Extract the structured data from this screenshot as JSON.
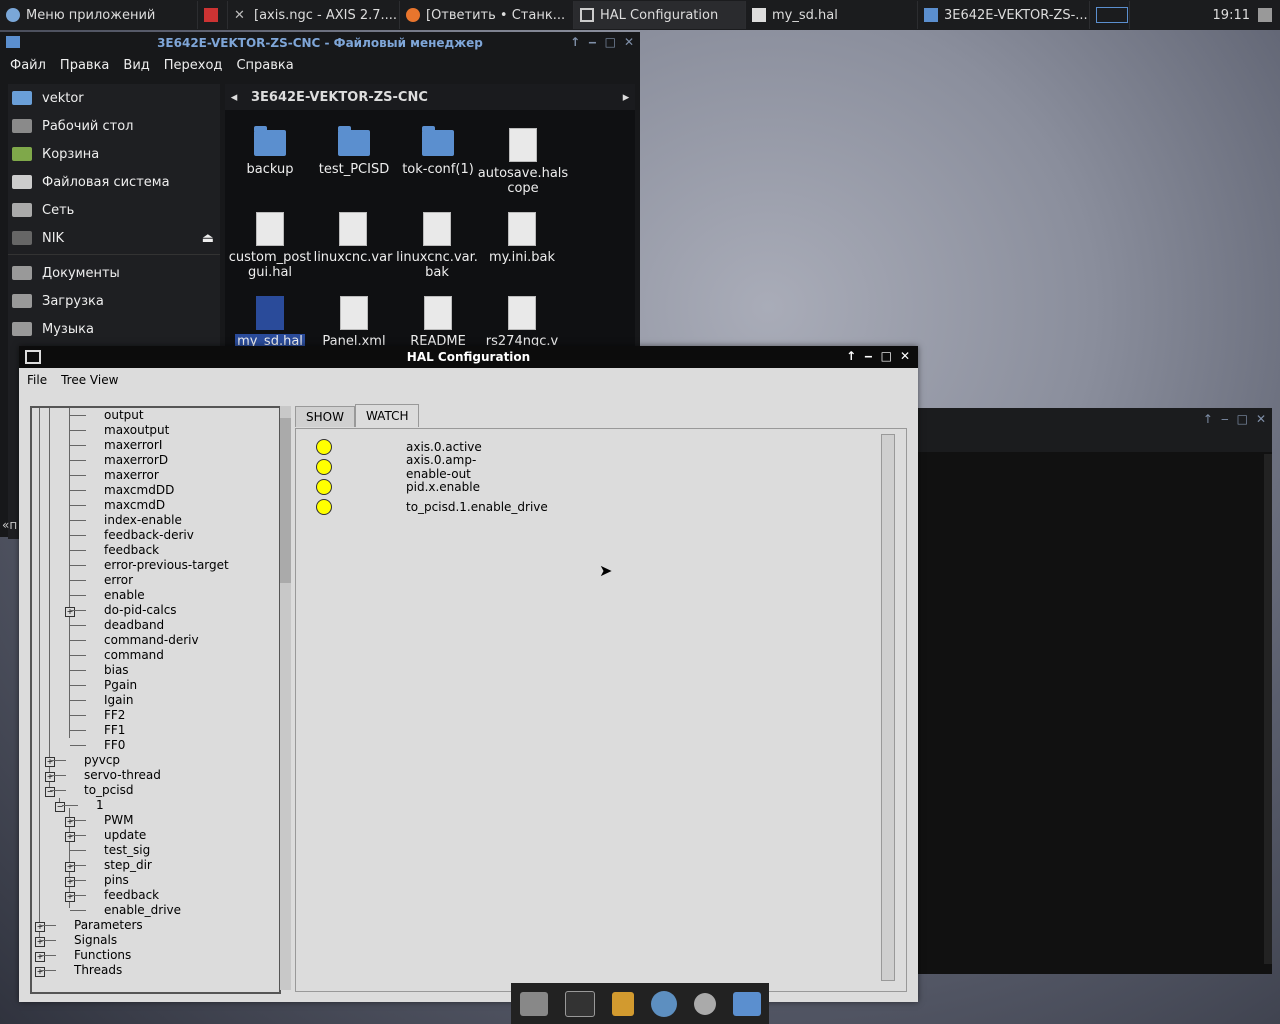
{
  "taskbar": {
    "app_menu": "Меню приложений",
    "tasks": [
      {
        "label": "[axis.ngc - AXIS 2.7...."
      },
      {
        "label": "[Ответить • Станк..."
      },
      {
        "label": "HAL Configuration"
      },
      {
        "label": "my_sd.hal"
      },
      {
        "label": "3E642E-VEKTOR-ZS-..."
      }
    ],
    "clock": "19:11"
  },
  "file_manager": {
    "title": "3E642E-VEKTOR-ZS-CNC - Файловый менеджер",
    "menu": [
      "Файл",
      "Правка",
      "Вид",
      "Переход",
      "Справка"
    ],
    "sidebar": [
      "vektor",
      "Рабочий стол",
      "Корзина",
      "Файловая система",
      "Сеть",
      "NIK",
      "Документы",
      "Загрузка",
      "Музыка"
    ],
    "path": "3E642E-VEKTOR-ZS-CNC",
    "files": [
      "backup",
      "test_PCISD",
      "tok-conf(1)",
      "autosave.halscope",
      "custom_postgui.hal",
      "linuxcnc.var",
      "linuxcnc.var.bak",
      "my.ini.bak",
      "my_sd.hal",
      "Panel.xml",
      "README",
      "rs274ngc.v"
    ],
    "partial_text": "«п"
  },
  "hal": {
    "title": "HAL Configuration",
    "menu": [
      "File",
      "Tree View"
    ],
    "tree": [
      "output",
      "maxoutput",
      "maxerrorI",
      "maxerrorD",
      "maxerror",
      "maxcmdDD",
      "maxcmdD",
      "index-enable",
      "feedback-deriv",
      "feedback",
      "error-previous-target",
      "error",
      "enable",
      "do-pid-calcs",
      "deadband",
      "command-deriv",
      "command",
      "bias",
      "Pgain",
      "Igain",
      "FF2",
      "FF1",
      "FF0",
      "pyvcp",
      "servo-thread",
      "to_pcisd",
      "1",
      "PWM",
      "update",
      "test_sig",
      "step_dir",
      "pins",
      "feedback",
      "enable_drive",
      "Parameters",
      "Signals",
      "Functions",
      "Threads"
    ],
    "tabs": [
      "SHOW",
      "WATCH"
    ],
    "watch": [
      "axis.0.active",
      "axis.0.amp-enable-out",
      "pid.x.enable",
      "to_pcisd.1.enable_drive"
    ],
    "led_color": "#ffff00"
  }
}
